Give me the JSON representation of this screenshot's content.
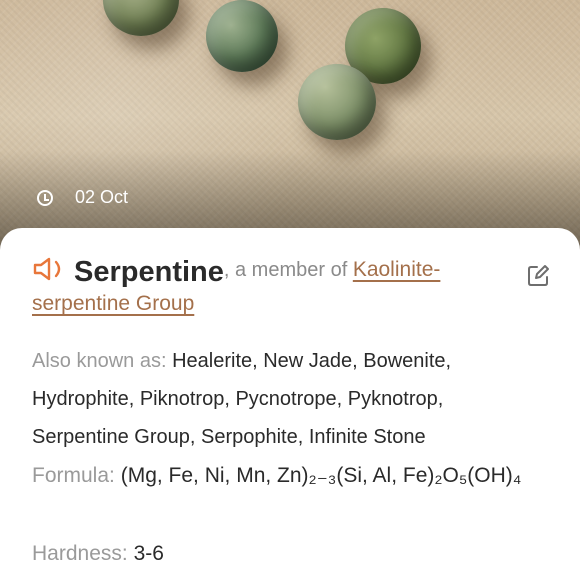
{
  "photo": {
    "date": "02 Oct",
    "date_icon": "clock-icon"
  },
  "mineral": {
    "name": "Serpentine",
    "member_prefix": ", a member of ",
    "group": "Kaolinite-serpentine Group",
    "speaker_icon": "speaker-icon",
    "edit_icon": "edit-icon",
    "accent_color": "#E8763A",
    "link_color": "#A4704B"
  },
  "details": {
    "aka_label": "Also known as:",
    "aka_value": "Healerite, New Jade, Bowenite, Hydrophite, Piknotrop, Pycnotrope, Pyknotrop, Serpentine Group, Serpophite, Infinite Stone",
    "formula_label": "Formula:",
    "formula_value": "(Mg, Fe, Ni, Mn, Zn)₂₋₃(Si, Al, Fe)₂O₅(OH)₄",
    "hardness_label": "Hardness:",
    "hardness_value": "3-6"
  }
}
